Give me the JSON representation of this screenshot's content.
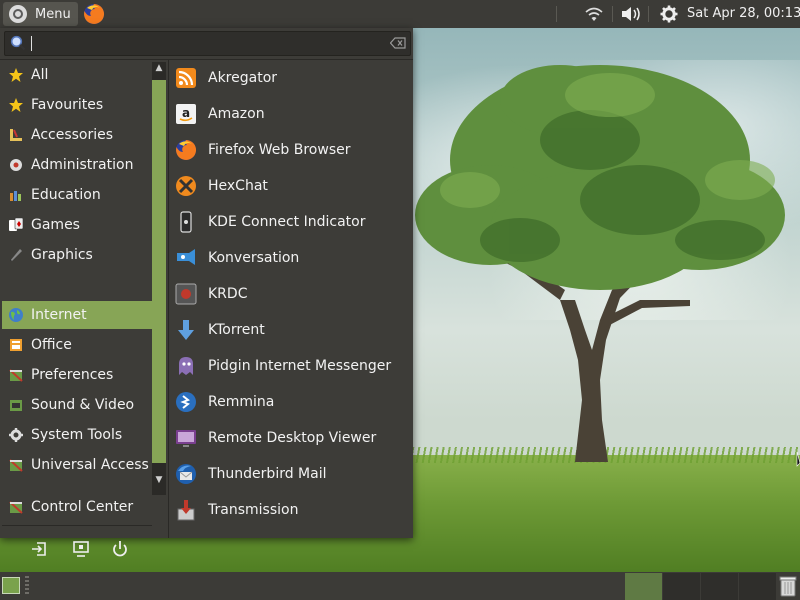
{
  "top_panel": {
    "menu_label": "Menu",
    "clock": "Sat Apr 28, 00:13"
  },
  "search": {
    "placeholder": "",
    "value": ""
  },
  "categories": [
    {
      "label": "All",
      "icon": "star-icon"
    },
    {
      "label": "Favourites",
      "icon": "star-icon"
    },
    {
      "label": "Accessories",
      "icon": "accessories-icon"
    },
    {
      "label": "Administration",
      "icon": "administration-icon"
    },
    {
      "label": "Education",
      "icon": "education-icon"
    },
    {
      "label": "Games",
      "icon": "games-icon"
    },
    {
      "label": "Graphics",
      "icon": "graphics-icon"
    },
    {
      "label": "Internet",
      "icon": "globe-icon",
      "selected": true
    },
    {
      "label": "Office",
      "icon": "office-icon"
    },
    {
      "label": "Preferences",
      "icon": "preferences-icon"
    },
    {
      "label": "Sound & Video",
      "icon": "sound-video-icon"
    },
    {
      "label": "System Tools",
      "icon": "gear-icon"
    },
    {
      "label": "Universal Access",
      "icon": "universal-access-icon"
    }
  ],
  "control_center": {
    "label": "Control Center",
    "icon": "control-center-icon"
  },
  "session_buttons": [
    "logout-icon",
    "lock-screen-icon",
    "power-icon"
  ],
  "apps": [
    {
      "label": "Akregator",
      "icon": "rss-icon"
    },
    {
      "label": "Amazon",
      "icon": "amazon-icon"
    },
    {
      "label": "Firefox Web Browser",
      "icon": "firefox-icon"
    },
    {
      "label": "HexChat",
      "icon": "hexchat-icon"
    },
    {
      "label": "KDE Connect Indicator",
      "icon": "kdeconnect-icon"
    },
    {
      "label": "Konversation",
      "icon": "konversation-icon"
    },
    {
      "label": "KRDC",
      "icon": "krdc-icon"
    },
    {
      "label": "KTorrent",
      "icon": "ktorrent-icon"
    },
    {
      "label": "Pidgin Internet Messenger",
      "icon": "pidgin-icon"
    },
    {
      "label": "Remmina",
      "icon": "remmina-icon"
    },
    {
      "label": "Remote Desktop Viewer",
      "icon": "remote-desktop-icon"
    },
    {
      "label": "Thunderbird Mail",
      "icon": "thunderbird-icon"
    },
    {
      "label": "Transmission",
      "icon": "transmission-icon"
    }
  ],
  "colors": {
    "panel": "#3c3b37",
    "menu_bg": "#3d3c38",
    "accent": "#87a556"
  }
}
